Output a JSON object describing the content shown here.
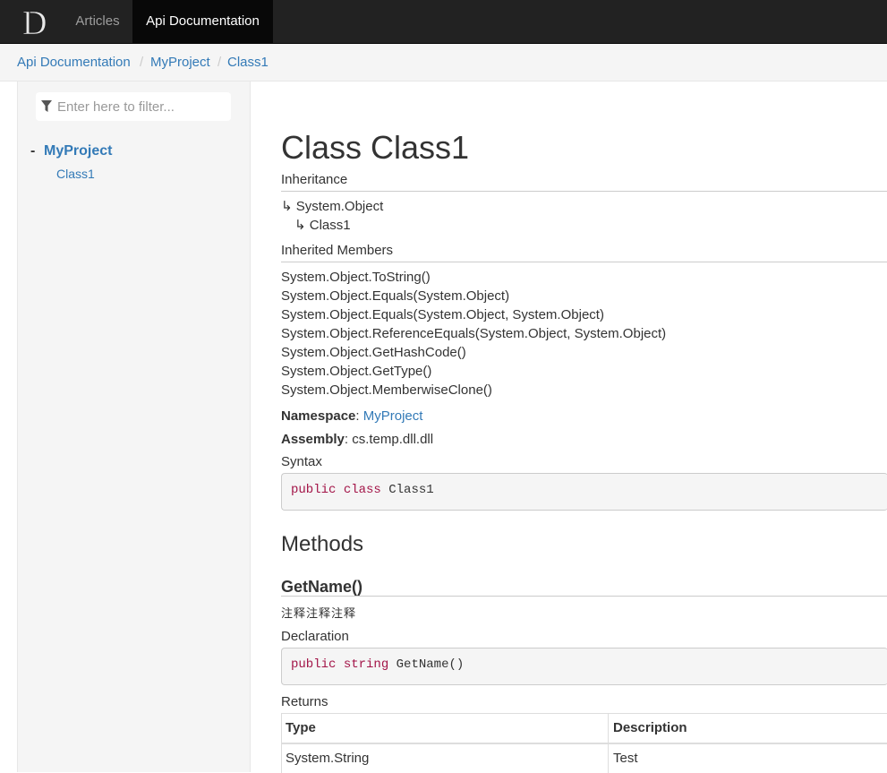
{
  "navbar": {
    "logo_letter": "D",
    "items": [
      {
        "label": "Articles",
        "active": false
      },
      {
        "label": "Api Documentation",
        "active": true
      }
    ]
  },
  "breadcrumb": {
    "items": [
      "Api Documentation",
      "MyProject",
      "Class1"
    ],
    "separator": "/"
  },
  "sidebar": {
    "filter_placeholder": "Enter here to filter...",
    "toc": {
      "expander": "-",
      "namespace": "MyProject",
      "classes": [
        "Class1"
      ]
    }
  },
  "article": {
    "title": "Class Class1",
    "inheritance_label": "Inheritance",
    "inheritance": [
      "System.Object",
      "Class1"
    ],
    "inheritance_arrow": "↳",
    "inherited_members_label": "Inherited Members",
    "inherited_members": [
      "System.Object.ToString()",
      "System.Object.Equals(System.Object)",
      "System.Object.Equals(System.Object, System.Object)",
      "System.Object.ReferenceEquals(System.Object, System.Object)",
      "System.Object.GetHashCode()",
      "System.Object.GetType()",
      "System.Object.MemberwiseClone()"
    ],
    "namespace_label": "Namespace",
    "namespace_value": "MyProject",
    "assembly_label": "Assembly",
    "assembly_value": "cs.temp.dll.dll",
    "syntax_label": "Syntax",
    "syntax_code": {
      "kw1": "public",
      "kw2": "class",
      "rest": "Class1"
    },
    "methods_heading": "Methods",
    "method": {
      "name": "GetName()",
      "summary": "注释注释注释",
      "declaration_label": "Declaration",
      "declaration_code": {
        "kw1": "public",
        "kw2": "string",
        "rest": "GetName()"
      },
      "returns_label": "Returns",
      "returns_table": {
        "headers": [
          "Type",
          "Description"
        ],
        "rows": [
          [
            "System.String",
            "Test"
          ]
        ]
      }
    }
  },
  "colors": {
    "navbar_bg": "#222222",
    "link": "#337ab7",
    "keyword": "#a31548"
  }
}
